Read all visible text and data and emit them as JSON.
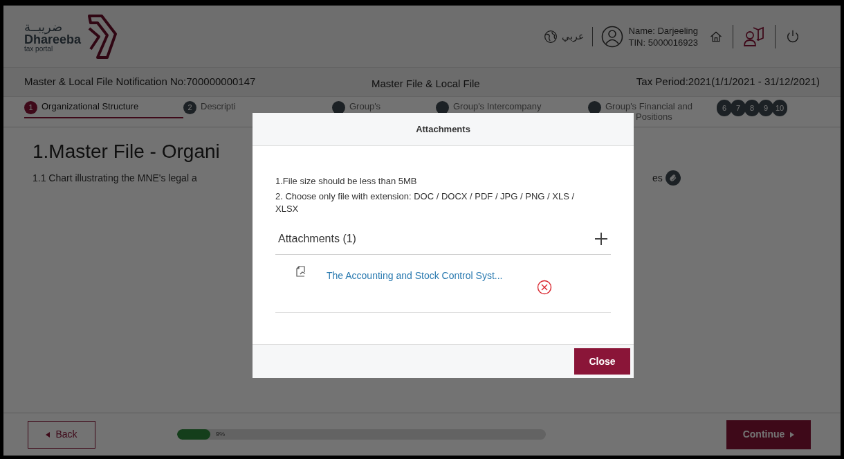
{
  "header": {
    "logo_arabic": "ضريبــة",
    "logo_name": "Dhareeba",
    "logo_tagline": "tax portal",
    "language": "عربي",
    "user_name": "Name: Darjeeling",
    "user_tin": "TIN: 5000016923"
  },
  "info_bar": {
    "notification": "Master & Local File Notification No:700000000147",
    "title": "Master File & Local File",
    "tax_period": "Tax Period:2021(1/1/2021 - 31/12/2021)"
  },
  "steps": [
    {
      "number": "1",
      "lines": [
        "Organizational Structure"
      ],
      "selected": true
    },
    {
      "number": "2",
      "lines": [
        "Descripti"
      ],
      "selected": false
    },
    {
      "lines": [
        "Group's"
      ],
      "selected": false
    },
    {
      "lines": [
        "Group's Intercompany"
      ],
      "selected": false
    },
    {
      "lines": [
        "Group's Financial and",
        "Positions"
      ],
      "selected": false
    }
  ],
  "more_steps": [
    "6",
    "7",
    "8",
    "9",
    "10"
  ],
  "content": {
    "heading": "1.Master File - Organi",
    "question": "1.1 Chart illustrating the MNE's legal a",
    "question_end": "es"
  },
  "footer": {
    "back": "Back",
    "progress": {
      "level": 0.09,
      "label": "9%"
    },
    "continue": "Continue"
  },
  "dialog": {
    "title": "Attachments",
    "notes": [
      "1.File size should be less than 5MB",
      "2. Choose only file with extension: DOC / DOCX / PDF / JPG / PNG / XLS / XLSX"
    ],
    "list_title": "Attachments (1)",
    "files": [
      {
        "name": "The Accounting and Stock Control Syst..."
      }
    ],
    "close": "Close"
  }
}
